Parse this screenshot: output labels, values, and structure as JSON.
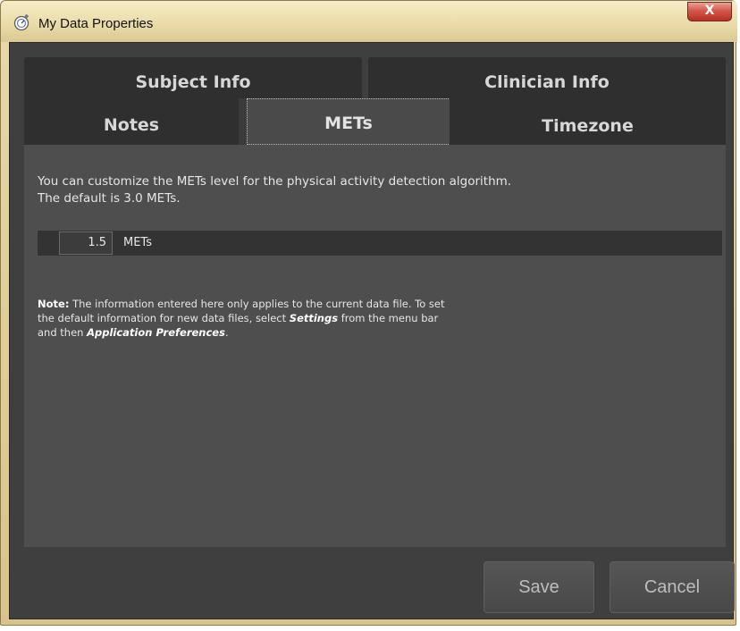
{
  "window": {
    "title": "My Data Properties",
    "close_label": "X"
  },
  "tabs": [
    {
      "label": "Subject Info",
      "selected": false
    },
    {
      "label": "Clinician Info",
      "selected": false
    },
    {
      "label": "Notes",
      "selected": false
    },
    {
      "label": "METs",
      "selected": true
    },
    {
      "label": "Timezone",
      "selected": false
    }
  ],
  "panel": {
    "description_line1": "You can customize the METs level for the physical activity detection algorithm.",
    "description_line2": "The default is 3.0 METs.",
    "mets_value": "1.5",
    "mets_unit": "METs",
    "note_label": "Note:",
    "note_text1": " The information entered here only applies to the current data file. To set",
    "note_text2a": "the default information for new data files, select ",
    "note_settings": "Settings",
    "note_text2b": " from the menu bar",
    "note_text3a": "and then ",
    "note_app_prefs": "Application Preferences",
    "note_text3b": "."
  },
  "buttons": {
    "save": "Save",
    "cancel": "Cancel"
  },
  "colors": {
    "titlebar": "#eadcaa",
    "client_bg": "#3f3f3f",
    "panel_bg": "#4e4e4e",
    "close": "#c7463a"
  }
}
